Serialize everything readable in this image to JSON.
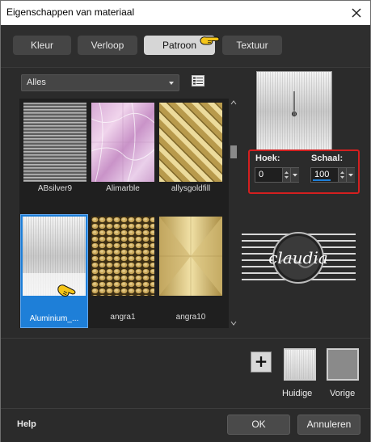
{
  "window": {
    "title": "Eigenschappen van materiaal"
  },
  "tabs": [
    {
      "label": "Kleur",
      "active": false
    },
    {
      "label": "Verloop",
      "active": false
    },
    {
      "label": "Patroon",
      "active": true
    },
    {
      "label": "Textuur",
      "active": false
    }
  ],
  "category_select": {
    "value": "Alles"
  },
  "patterns": [
    {
      "label": "ABsilver9",
      "selected": false
    },
    {
      "label": "Alimarble",
      "selected": false
    },
    {
      "label": "allysgoldfill",
      "selected": false
    },
    {
      "label": "Aluminium_...",
      "selected": true
    },
    {
      "label": "angra1",
      "selected": false
    },
    {
      "label": "angra10",
      "selected": false
    }
  ],
  "angle": {
    "label": "Hoek:",
    "value": "0"
  },
  "scale": {
    "label": "Schaal:",
    "value": "100"
  },
  "watermark": {
    "text": "claudia"
  },
  "swatches": {
    "current_label": "Huidige",
    "previous_label": "Vorige"
  },
  "footer": {
    "help": "Help",
    "ok": "OK",
    "cancel": "Annuleren"
  },
  "colors": {
    "accent": "#1e7fd8",
    "highlight_box": "#d41f1f",
    "previous_swatch": "#8a8a8a"
  }
}
